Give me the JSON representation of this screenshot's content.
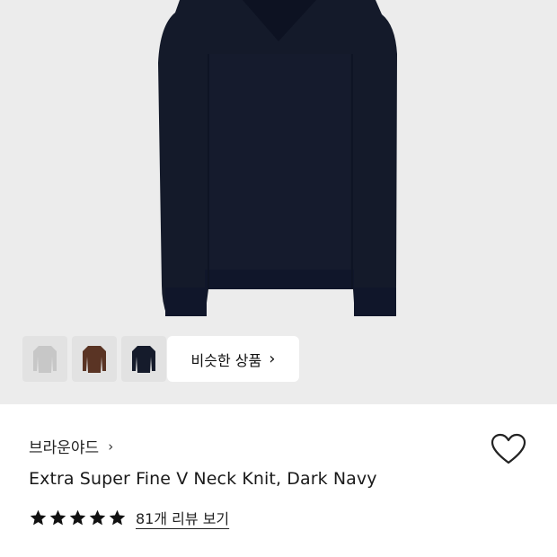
{
  "product": {
    "brand": "브라운야드",
    "title": "Extra Super Fine V Neck Knit, Dark Navy",
    "rating": 5,
    "review_link": "81개 리뷰 보기"
  },
  "hero": {
    "similar_button_label": "비슷한 상품",
    "thumbnails": [
      {
        "name": "grey",
        "color": "#c7c7c7"
      },
      {
        "name": "brown",
        "color": "#5a3424"
      },
      {
        "name": "navy",
        "color": "#151b2b"
      }
    ],
    "main_color": "#141a2a"
  },
  "colors": {
    "hero_bg": "#ececec",
    "star": "#111111"
  },
  "icons": {
    "wishlist": "heart-outline-icon",
    "brand_arrow": "chevron-right-icon",
    "similar_arrow": "chevron-right-icon",
    "rating": "star-icon"
  }
}
